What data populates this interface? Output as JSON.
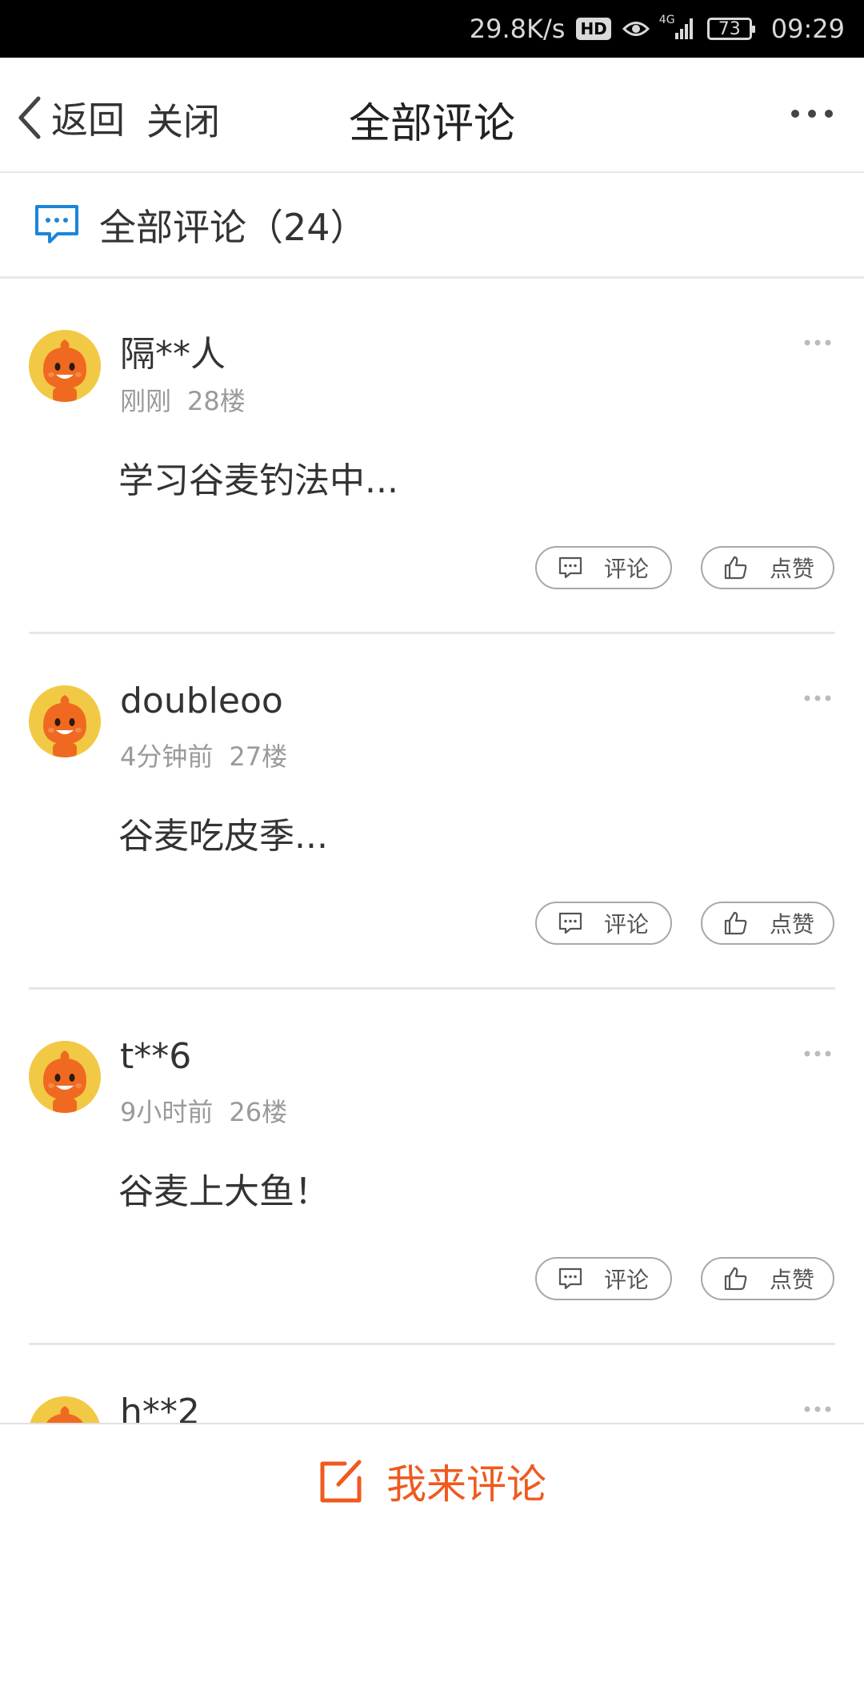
{
  "status_bar": {
    "net_speed": "29.8K/s",
    "hd_badge": "HD",
    "network": "4G",
    "battery": "73",
    "time": "09:29"
  },
  "nav": {
    "back_label": "返回",
    "close_label": "关闭",
    "title": "全部评论"
  },
  "comments_header": {
    "label": "全部评论（24）"
  },
  "comments": [
    {
      "username": "隔**人",
      "time": "刚刚",
      "floor": "28楼",
      "text": "学习谷麦钓法中...",
      "reply_label": "评论",
      "like_label": "点赞"
    },
    {
      "username": "doubleoo",
      "time": "4分钟前",
      "floor": "27楼",
      "text": "谷麦吃皮季...",
      "reply_label": "评论",
      "like_label": "点赞"
    },
    {
      "username": "t**6",
      "time": "9小时前",
      "floor": "26楼",
      "text": "谷麦上大鱼！",
      "reply_label": "评论",
      "like_label": "点赞"
    },
    {
      "username": "h**2"
    }
  ],
  "bottom_bar": {
    "label": "我来评论"
  },
  "colors": {
    "accent": "#ef5a1f",
    "icon_blue": "#1b86d9",
    "avatar_bg": "#f2c945"
  }
}
